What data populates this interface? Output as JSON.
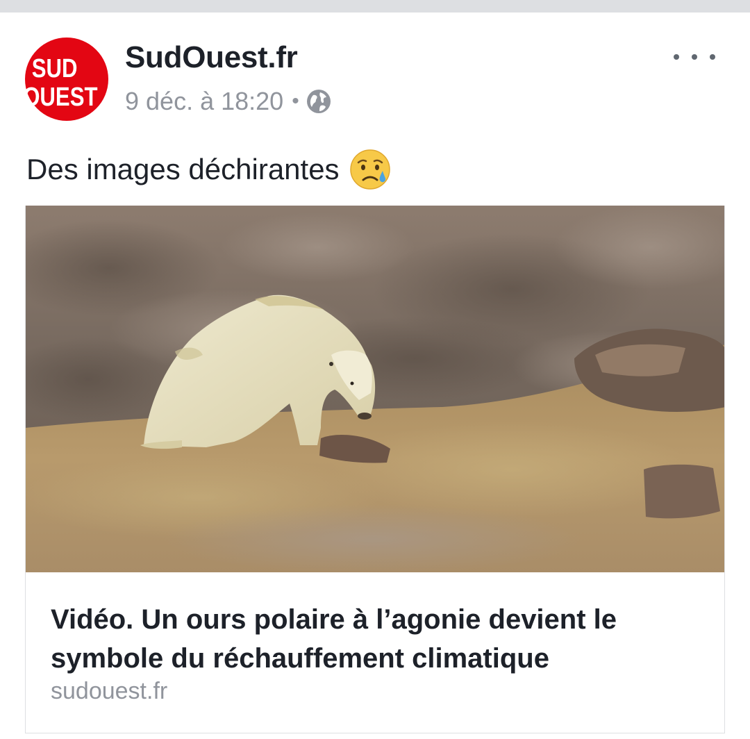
{
  "post": {
    "page_name": "SudOuest.fr",
    "timestamp": "9 déc. à 18:20",
    "separator": "•",
    "privacy_icon": "globe-icon",
    "options_icon": "more-options-icon",
    "text": "Des images déchirantes",
    "emoji": "sad-tear-face-icon"
  },
  "avatar": {
    "line1": "SUD",
    "line2": "OUEST",
    "color": "#e30613"
  },
  "link": {
    "image_description_icon": "polar-bear-photo",
    "headline": "Vidéo. Un ours polaire à l’agonie devient le symbole du réchauffement climatique",
    "domain": "sudouest.fr"
  },
  "colors": {
    "primary_text": "#1d2129",
    "secondary_text": "#90949c",
    "border": "#dddfe2"
  }
}
